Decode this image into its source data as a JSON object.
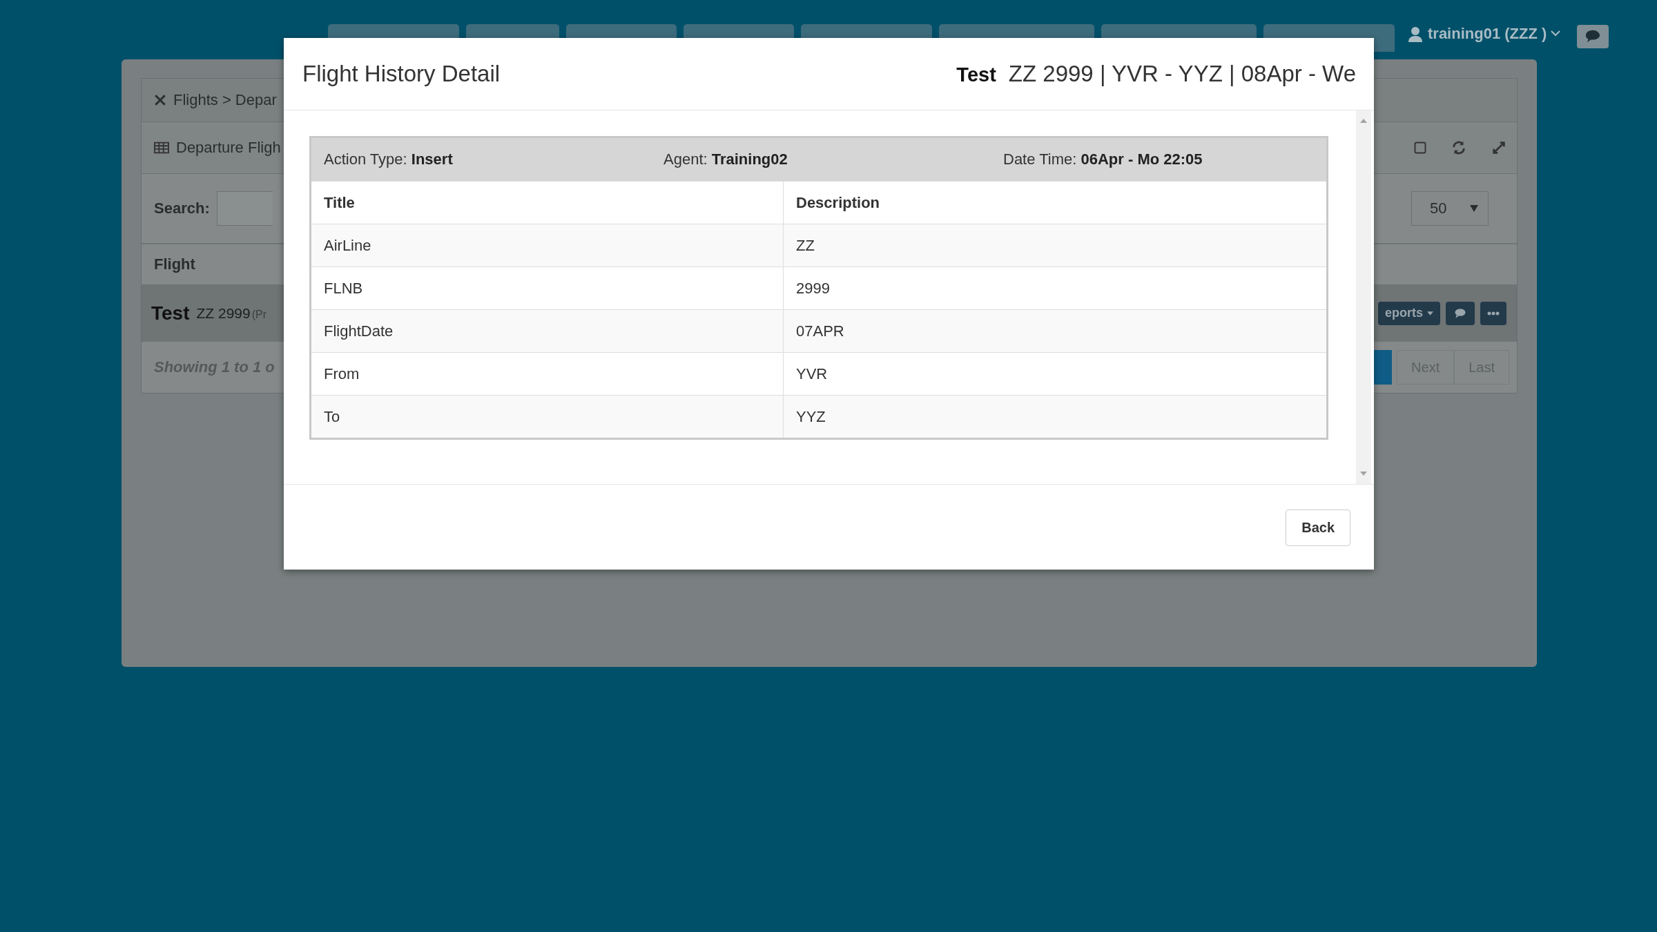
{
  "top_bar": {
    "user": "training01 (ZZZ )"
  },
  "background": {
    "breadcrumb": "Flights > Depar",
    "panel_title": "Departure Fligh",
    "search_label": "Search:",
    "page_size": "50",
    "column": "Flight",
    "row": {
      "name": "Test",
      "flight": "ZZ 2999",
      "note": "(Pr",
      "reports": "eports"
    },
    "info": "Showing 1 to 1 o",
    "pager": [
      "Next",
      "Last"
    ]
  },
  "modal": {
    "title": "Flight History Detail",
    "flight_name": "Test",
    "flight_summary": "ZZ 2999 | YVR - YYZ | 08Apr - We",
    "meta": [
      {
        "label": "Action Type:",
        "value": "Insert"
      },
      {
        "label": "Agent:",
        "value": "Training02"
      },
      {
        "label": "Date Time:",
        "value": "06Apr - Mo 22:05"
      }
    ],
    "columns": [
      "Title",
      "Description"
    ],
    "rows": [
      [
        "AirLine",
        "ZZ"
      ],
      [
        "FLNB",
        "2999"
      ],
      [
        "FlightDate",
        "07APR"
      ],
      [
        "From",
        "YVR"
      ],
      [
        "To",
        "YYZ"
      ]
    ],
    "back": "Back"
  }
}
